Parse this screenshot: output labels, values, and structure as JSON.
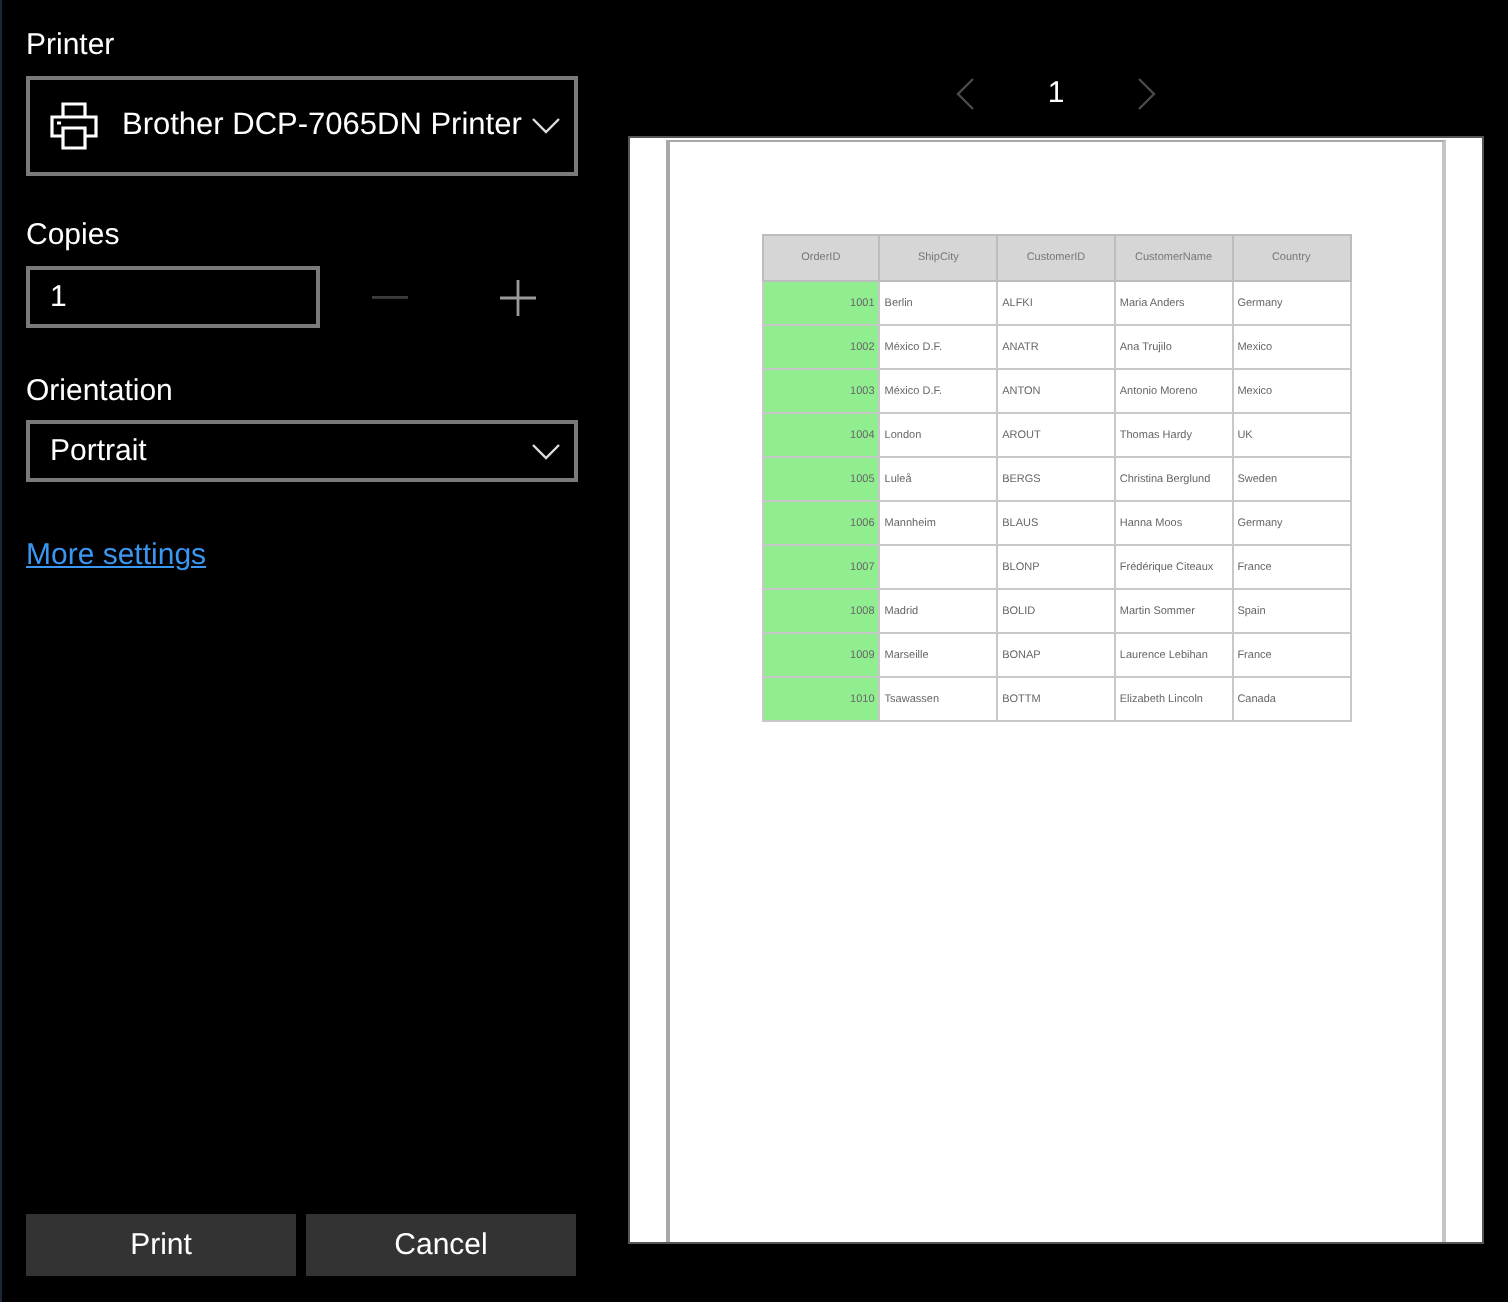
{
  "printer": {
    "label": "Printer",
    "selected_printer": "Brother DCP-7065DN Printer"
  },
  "copies": {
    "label": "Copies",
    "value": "1",
    "decrease_disabled": true,
    "increase_disabled": false
  },
  "orientation": {
    "label": "Orientation",
    "value": "Portrait"
  },
  "more_settings_link": "More settings",
  "buttons": [
    "Print",
    "Cancel"
  ],
  "page_nav": {
    "page": "1",
    "previous_disabled": true,
    "next_disabled": true
  },
  "preview": {
    "table": {
      "columns": [
        {
          "label": "OrderID",
          "highlighted": true
        },
        {
          "label": "ShipCity",
          "highlighted": false
        },
        {
          "label": "CustomerID",
          "highlighted": false
        },
        {
          "label": "CustomerName",
          "highlighted": false
        },
        {
          "label": "Country",
          "highlighted": false
        }
      ],
      "rows": [
        {
          "order_id": "1001",
          "ship_city": "Berlin",
          "customer_id": "ALFKI",
          "customer_name": "Maria Anders",
          "country": "Germany"
        },
        {
          "order_id": "1002",
          "ship_city": "México D.F.",
          "customer_id": "ANATR",
          "customer_name": "Ana Trujilo",
          "country": "Mexico"
        },
        {
          "order_id": "1003",
          "ship_city": "México D.F.",
          "customer_id": "ANTON",
          "customer_name": "Antonio Moreno",
          "country": "Mexico"
        },
        {
          "order_id": "1004",
          "ship_city": "London",
          "customer_id": "AROUT",
          "customer_name": "Thomas Hardy",
          "country": "UK"
        },
        {
          "order_id": "1005",
          "ship_city": "Luleå",
          "customer_id": "BERGS",
          "customer_name": "Christina Berglund",
          "country": "Sweden"
        },
        {
          "order_id": "1006",
          "ship_city": "Mannheim",
          "customer_id": "BLAUS",
          "customer_name": "Hanna Moos",
          "country": "Germany"
        },
        {
          "order_id": "1007",
          "customer_id": "BLONP",
          "customer_name": "Frédérique Citeaux",
          "country": "France"
        },
        {
          "order_id": "1008",
          "ship_city": "Madrid",
          "customer_id": "BOLID",
          "customer_name": "Martin Sommer",
          "country": "Spain"
        },
        {
          "order_id": "1009",
          "ship_city": "Marseille",
          "customer_id": "BONAP",
          "customer_name": "Laurence Lebihan",
          "country": "France"
        },
        {
          "order_id": "1010",
          "ship_city": "Tsawassen",
          "customer_id": "BOTTM",
          "customer_name": "Elizabeth Lincoln",
          "country": "Canada"
        }
      ]
    }
  }
}
